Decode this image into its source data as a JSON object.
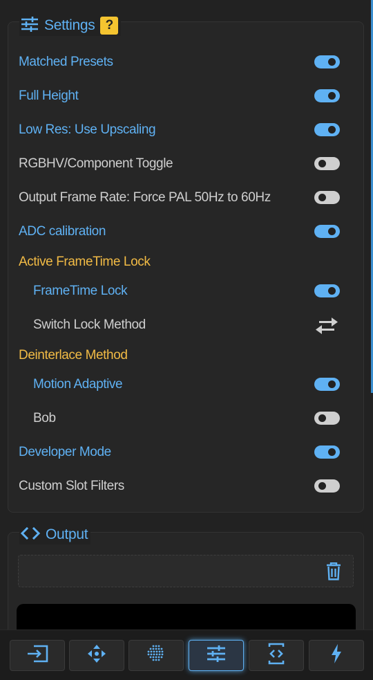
{
  "settings": {
    "title": "Settings",
    "help_label": "?",
    "items": [
      {
        "label": "Matched Presets",
        "state": "on"
      },
      {
        "label": "Full Height",
        "state": "on"
      },
      {
        "label": "Low Res: Use Upscaling",
        "state": "on"
      },
      {
        "label": "RGBHV/Component Toggle",
        "state": "off"
      },
      {
        "label": "Output Frame Rate: Force PAL 50Hz to 60Hz",
        "state": "off"
      },
      {
        "label": "ADC calibration",
        "state": "on"
      }
    ],
    "frametime_section": {
      "title": "Active FrameTime Lock",
      "items": [
        {
          "label": "FrameTime Lock",
          "state": "on"
        },
        {
          "label": "Switch Lock Method",
          "icon": "swap-arrows-icon"
        }
      ]
    },
    "deinterlace_section": {
      "title": "Deinterlace Method",
      "items": [
        {
          "label": "Motion Adaptive",
          "state": "on"
        },
        {
          "label": "Bob",
          "state": "off"
        }
      ]
    },
    "bottom_items": [
      {
        "label": "Developer Mode",
        "state": "on"
      },
      {
        "label": "Custom Slot Filters",
        "state": "off"
      }
    ]
  },
  "output": {
    "title": "Output",
    "field_value": "",
    "clear_icon": "trash-icon"
  },
  "bottom_nav": {
    "items": [
      {
        "icon": "input-icon",
        "active": false
      },
      {
        "icon": "move-arrows-icon",
        "active": false
      },
      {
        "icon": "dot-grid-icon",
        "active": false
      },
      {
        "icon": "sliders-icon",
        "active": true
      },
      {
        "icon": "code-device-icon",
        "active": false
      },
      {
        "icon": "lightning-icon",
        "active": false
      }
    ]
  },
  "colors": {
    "accent": "#5fb1f3",
    "section": "#f2bb45",
    "help_badge": "#f4c430",
    "background": "#222222"
  }
}
